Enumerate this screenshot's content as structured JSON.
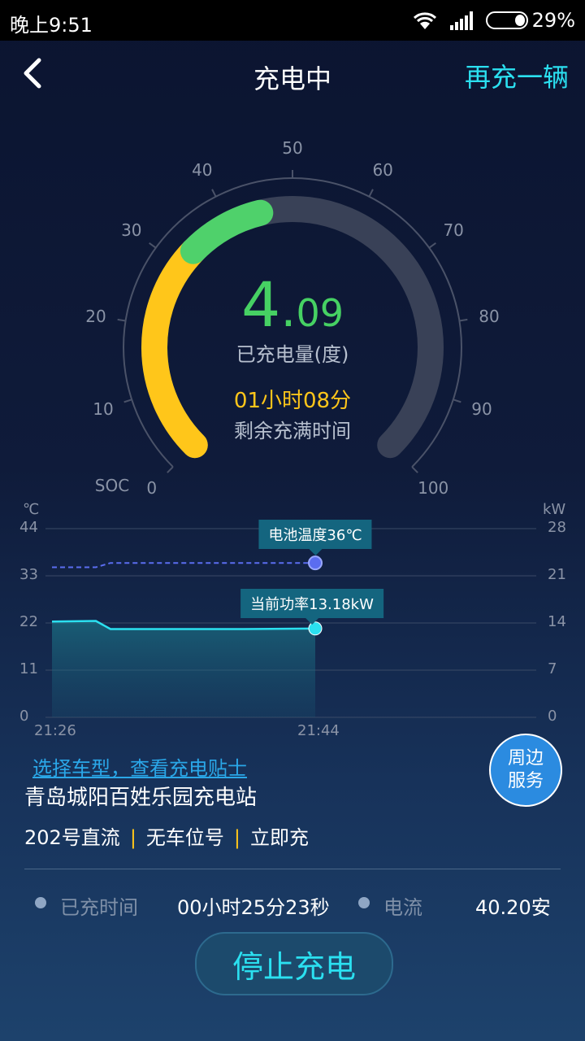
{
  "status_bar": {
    "time": "晚上9:51",
    "battery": "29%"
  },
  "header": {
    "title": "充电中",
    "recharge_label": "再充一辆"
  },
  "gauge": {
    "energy_int": "4",
    "energy_dot": ".",
    "energy_dec": "09",
    "energy_label": "已充电量(度)",
    "remaining_time": "01小时08分",
    "remaining_label": "剩余充满时间",
    "soc_label": "SOC",
    "soc_percent": 45,
    "ticks": [
      "0",
      "10",
      "20",
      "30",
      "40",
      "50",
      "60",
      "70",
      "80",
      "90",
      "100"
    ],
    "colors": {
      "low": "#ffc61a",
      "high": "#4fd16b",
      "track": "#394157"
    }
  },
  "chart": {
    "left_unit": "℃",
    "right_unit": "kW",
    "left_ticks": [
      "44",
      "33",
      "22",
      "11",
      "0"
    ],
    "right_ticks": [
      "28",
      "21",
      "14",
      "7",
      "0"
    ],
    "x_ticks": [
      "21:26",
      "21:44"
    ],
    "temp_tooltip": "电池温度36℃",
    "power_tooltip": "当前功率13.18kW",
    "colors": {
      "temp": "#5b6df0",
      "power": "#2be0f0"
    }
  },
  "chart_data": {
    "type": "line",
    "x": [
      "21:26",
      "21:44"
    ],
    "series": [
      {
        "name": "电池温度",
        "unit": "℃",
        "axis": "left",
        "values": [
          35,
          35,
          36,
          36,
          36
        ]
      },
      {
        "name": "当前功率",
        "unit": "kW",
        "axis": "right",
        "values": [
          14.2,
          14.3,
          13.1,
          13.1,
          13.18
        ]
      }
    ],
    "left_ylim": [
      0,
      44
    ],
    "right_ylim": [
      0,
      28
    ]
  },
  "station": {
    "tips_link": "选择车型，查看充电贴士",
    "name": "青岛城阳百姓乐园充电站",
    "pile": "202号直流",
    "space": "无车位号",
    "mode": "立即充",
    "nearby_line1": "周边",
    "nearby_line2": "服务"
  },
  "info": {
    "charged_time_label": "已充时间",
    "charged_time_value": "00小时25分23秒",
    "current_label": "电流",
    "current_value": "40.20安"
  },
  "stop_button": "停止充电"
}
